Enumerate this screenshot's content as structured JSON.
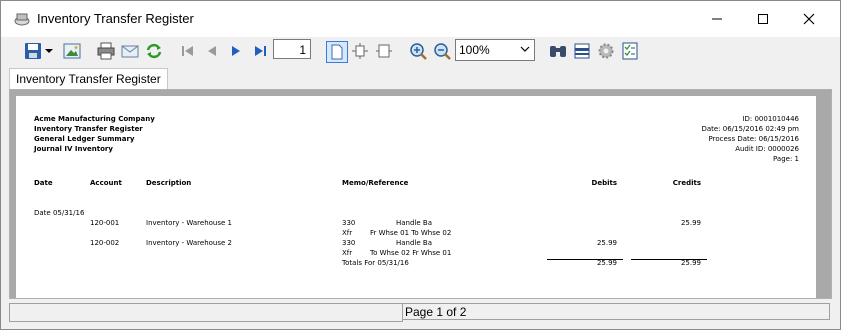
{
  "window": {
    "title": "Inventory Transfer Register"
  },
  "toolbar": {
    "page_number": "1",
    "zoom_value": "100%"
  },
  "tab": {
    "label": "Inventory Transfer Register"
  },
  "report": {
    "header_left": [
      "Acme Manufacturing Company",
      "Inventory Transfer Register",
      "General Ledger Summary",
      "Journal IV Inventory"
    ],
    "header_right": [
      "ID: 0001010446",
      "Date: 06/15/2016 02:49 pm",
      "Process Date: 06/15/2016",
      "Audit ID: 0000026",
      "Page: 1"
    ],
    "columns": {
      "date": "Date",
      "account": "Account",
      "description": "Description",
      "memo": "Memo/Reference",
      "debits": "Debits",
      "credits": "Credits"
    },
    "date_group": "Date 05/31/16",
    "rows": [
      {
        "account": "120-001",
        "description": "Inventory - Warehouse 1",
        "memo_code": "330",
        "memo_text": "Handle Ba",
        "memo2_code": "Xfr",
        "memo2_text": "Fr Whse 01 To Whse 02",
        "debit": "",
        "credit": "25.99"
      },
      {
        "account": "120-002",
        "description": "Inventory - Warehouse 2",
        "memo_code": "330",
        "memo_text": "Handle Ba",
        "memo2_code": "Xfr",
        "memo2_text": "To Whse 02 Fr Whse 01",
        "debit": "25.99",
        "credit": ""
      }
    ],
    "totals": {
      "label": "Totals For 05/31/16",
      "debit": "25.99",
      "credit": "25.99"
    }
  },
  "status": {
    "page_info": "Page 1 of 2"
  }
}
